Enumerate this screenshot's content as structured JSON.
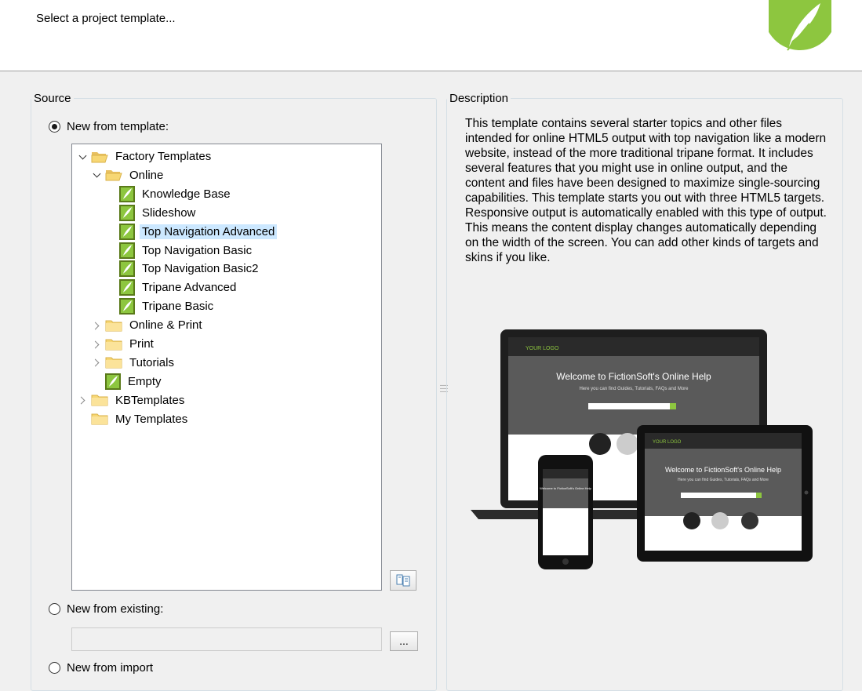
{
  "header": {
    "title": "Select a project template..."
  },
  "source": {
    "legend": "Source",
    "option_template": "New from template:",
    "option_existing": "New from existing:",
    "option_import": "New from import",
    "existing_value": "",
    "browse_label": "..."
  },
  "tree": {
    "items": [
      {
        "label": "Factory Templates",
        "level": 0,
        "type": "folder-open",
        "expander": "down"
      },
      {
        "label": "Online",
        "level": 1,
        "type": "folder-open",
        "expander": "down"
      },
      {
        "label": "Knowledge Base",
        "level": 2,
        "type": "template"
      },
      {
        "label": "Slideshow",
        "level": 2,
        "type": "template"
      },
      {
        "label": "Top Navigation Advanced",
        "level": 2,
        "type": "template",
        "selected": true
      },
      {
        "label": "Top Navigation Basic",
        "level": 2,
        "type": "template"
      },
      {
        "label": "Top Navigation Basic2",
        "level": 2,
        "type": "template"
      },
      {
        "label": "Tripane Advanced",
        "level": 2,
        "type": "template"
      },
      {
        "label": "Tripane Basic",
        "level": 2,
        "type": "template"
      },
      {
        "label": "Online & Print",
        "level": 1,
        "type": "folder",
        "expander": "right"
      },
      {
        "label": "Print",
        "level": 1,
        "type": "folder",
        "expander": "right"
      },
      {
        "label": "Tutorials",
        "level": 1,
        "type": "folder",
        "expander": "right"
      },
      {
        "label": "Empty",
        "level": 1,
        "type": "template"
      },
      {
        "label": "KBTemplates",
        "level": 0,
        "type": "folder",
        "expander": "right"
      },
      {
        "label": "My Templates",
        "level": 0,
        "type": "folder"
      }
    ]
  },
  "description": {
    "legend": "Description",
    "text": "This template contains several starter topics and other files intended for online HTML5 output with top navigation like a modern website, instead of the more traditional tripane format. It includes several features that you might use in online output, and the content and files have been designed to maximize single-sourcing capabilities. This template starts you out with three HTML5 targets. Responsive output is automatically enabled with this type of output. This means the content display changes automatically depending on the width of the screen. You can add other kinds of targets and skins if you like.",
    "preview": {
      "laptop_heading": "Welcome to FictionSoft's Online Help",
      "laptop_sub": "Here you can find Guides, Tutorials, FAQs and More",
      "tablet_heading": "Welcome to FictionSoft's Online Help",
      "tablet_sub": "Here you can find Guides, Tutorials, FAQs and More",
      "phone_heading": "Welcome to FictionSoft's Online Help",
      "logo_text": "YOUR LOGO"
    }
  },
  "colors": {
    "accent": "#8dc63f",
    "selection": "#cce8ff",
    "border": "#d5dfe5"
  }
}
